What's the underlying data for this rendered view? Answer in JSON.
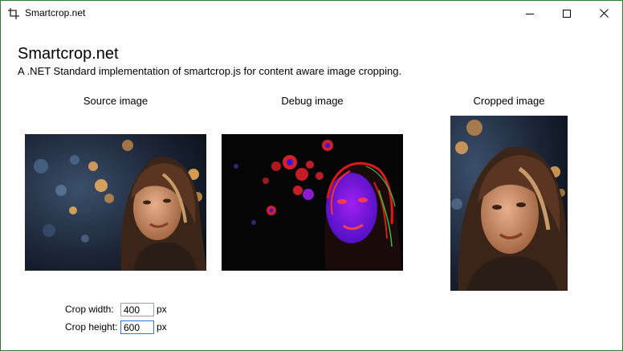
{
  "window": {
    "title": "Smartcrop.net",
    "controls": [
      "minimize-icon",
      "maximize-icon",
      "close-icon"
    ]
  },
  "header": {
    "title": "Smartcrop.net",
    "subtitle": "A .NET Standard implementation of smartcrop.js for content aware image cropping."
  },
  "panels": {
    "source_label": "Source image",
    "debug_label": "Debug image",
    "cropped_label": "Cropped image"
  },
  "crop": {
    "width_label": "Crop width:",
    "width_value": "400",
    "width_unit": "px",
    "height_label": "Crop height:",
    "height_value": "600",
    "height_unit": "px"
  },
  "colors": {
    "window_border": "#2f7d32",
    "focus_border": "#2b79d9"
  }
}
